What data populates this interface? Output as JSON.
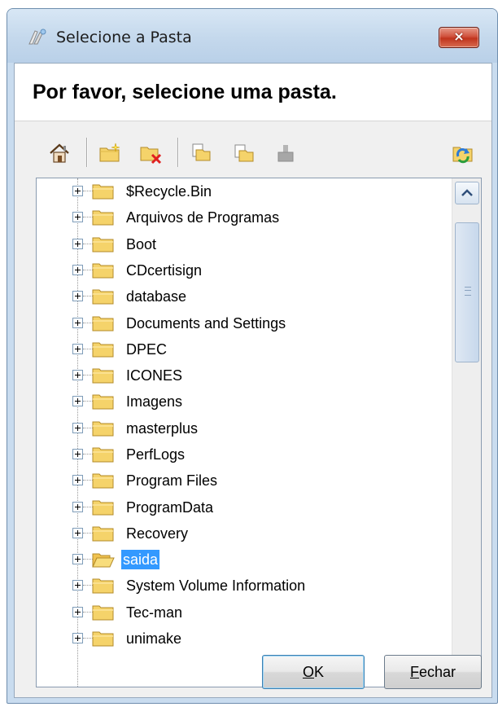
{
  "window": {
    "title": "Selecione a Pasta",
    "close_glyph": "×"
  },
  "header": {
    "prompt": "Por favor, selecione uma pasta."
  },
  "toolbar": {
    "buttons": [
      "home-icon",
      "new-folder-icon",
      "delete-folder-icon",
      "copy-icon",
      "paste-icon",
      "disk-icon",
      "refresh-icon"
    ]
  },
  "tree": {
    "items": [
      {
        "label": "$Recycle.Bin",
        "selected": false
      },
      {
        "label": "Arquivos de Programas",
        "selected": false
      },
      {
        "label": "Boot",
        "selected": false
      },
      {
        "label": "CDcertisign",
        "selected": false
      },
      {
        "label": "database",
        "selected": false
      },
      {
        "label": "Documents and Settings",
        "selected": false
      },
      {
        "label": "DPEC",
        "selected": false
      },
      {
        "label": "ICONES",
        "selected": false
      },
      {
        "label": "Imagens",
        "selected": false
      },
      {
        "label": "masterplus",
        "selected": false
      },
      {
        "label": "PerfLogs",
        "selected": false
      },
      {
        "label": "Program Files",
        "selected": false
      },
      {
        "label": "ProgramData",
        "selected": false
      },
      {
        "label": "Recovery",
        "selected": false
      },
      {
        "label": "saida",
        "selected": true
      },
      {
        "label": "System Volume Information",
        "selected": false
      },
      {
        "label": "Tec-man",
        "selected": false
      },
      {
        "label": "unimake",
        "selected": false
      }
    ]
  },
  "buttons": {
    "ok": {
      "accel": "O",
      "rest": "K"
    },
    "close": {
      "accel": "F",
      "rest": "echar"
    }
  },
  "colors": {
    "selection": "#3399ff",
    "folder": "#f5d36a",
    "close_button": "#c9432c"
  }
}
